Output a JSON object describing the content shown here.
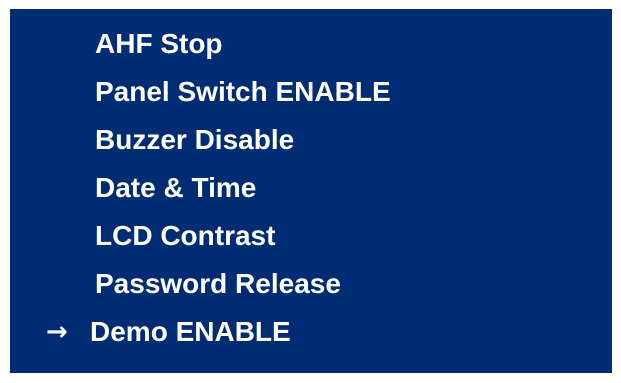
{
  "menu": {
    "items": [
      {
        "label": "AHF Stop",
        "selected": false
      },
      {
        "label": "Panel Switch ENABLE",
        "selected": false
      },
      {
        "label": "Buzzer Disable",
        "selected": false
      },
      {
        "label": "Date & Time",
        "selected": false
      },
      {
        "label": "LCD Contrast",
        "selected": false
      },
      {
        "label": "Password Release",
        "selected": false
      },
      {
        "label": "Demo ENABLE",
        "selected": true
      }
    ],
    "cursor_icon": "arrow-right-icon",
    "cursor_glyph": "→"
  },
  "colors": {
    "panel_background": "#002c73",
    "text": "#ffffff",
    "page_background": "#ffffff"
  }
}
